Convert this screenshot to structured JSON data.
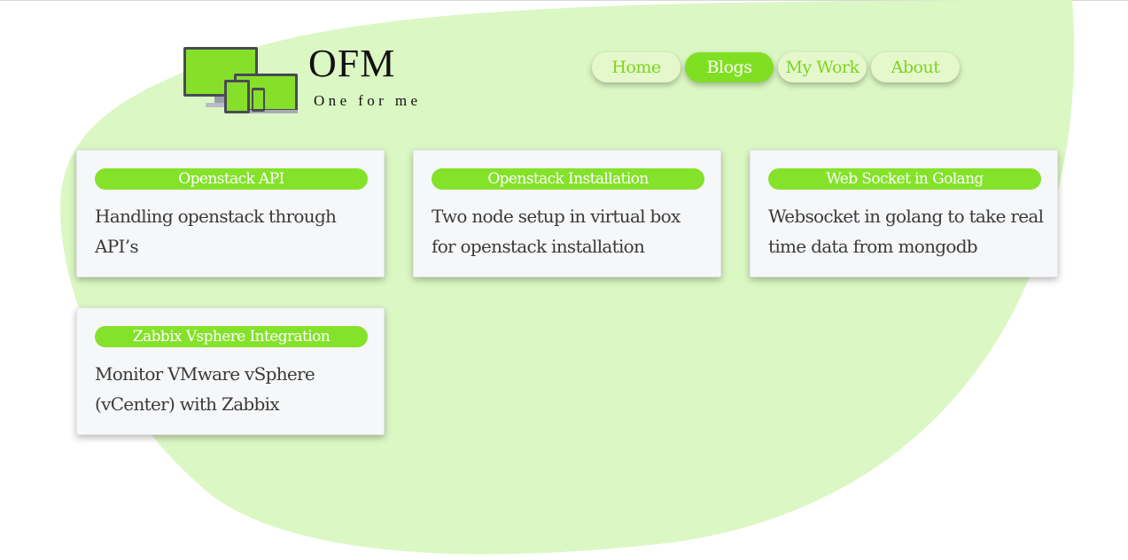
{
  "colors": {
    "accent": "#7fe023",
    "blob": "#dbf7c3",
    "nav_bg": "#e5f8cc",
    "card_bg": "#f6f7f9"
  },
  "brand": {
    "title": "OFM",
    "tagline": "One for me",
    "logo_icon": "devices-icon"
  },
  "nav": {
    "items": [
      {
        "label": "Home",
        "active": false
      },
      {
        "label": "Blogs",
        "active": true
      },
      {
        "label": "My Work",
        "active": false
      },
      {
        "label": "About",
        "active": false
      }
    ]
  },
  "posts": [
    {
      "category": "Openstack API",
      "summary": "Handling openstack through API’s"
    },
    {
      "category": "Openstack Installation",
      "summary": "Two node setup in virtual box for openstack installation"
    },
    {
      "category": "Web Socket in Golang",
      "summary": "Websocket in golang to take real time data from mongodb"
    },
    {
      "category": "Zabbix Vsphere Integration",
      "summary": "Monitor VMware vSphere (vCenter) with Zabbix"
    }
  ]
}
